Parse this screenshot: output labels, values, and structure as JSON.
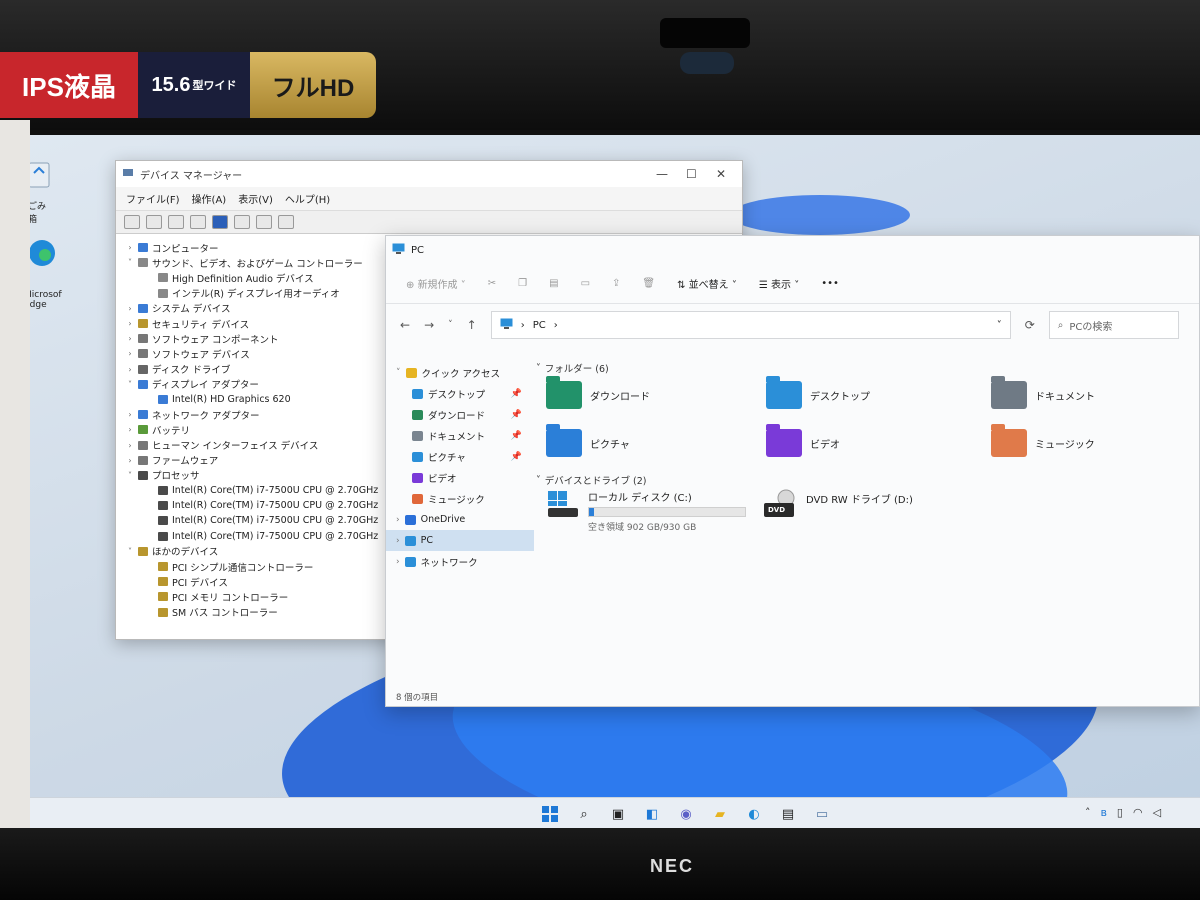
{
  "stickers": {
    "ips": "IPS液晶",
    "size": "15.6",
    "size_unit": "型ワイド",
    "fullhd": "フルHD"
  },
  "bezel": {
    "brand": "NEC"
  },
  "desktop": {
    "icons": [
      {
        "label": "ごみ箱",
        "icon": "recycle-bin-icon"
      },
      {
        "label": "Microsoft Edge",
        "icon": "edge-icon"
      }
    ]
  },
  "device_manager": {
    "title": "デバイス マネージャー",
    "menu": [
      "ファイル(F)",
      "操作(A)",
      "表示(V)",
      "ヘルプ(H)"
    ],
    "tree": [
      {
        "label": "コンピューター",
        "depth": 1,
        "expand": "collapsed",
        "icon_color": "#3a7bd5"
      },
      {
        "label": "サウンド、ビデオ、およびゲーム コントローラー",
        "depth": 1,
        "expand": "expanded",
        "icon_color": "#888888"
      },
      {
        "label": "High Definition Audio デバイス",
        "depth": 2,
        "expand": "none",
        "icon_color": "#888888"
      },
      {
        "label": "インテル(R) ディスプレイ用オーディオ",
        "depth": 2,
        "expand": "none",
        "icon_color": "#888888"
      },
      {
        "label": "システム デバイス",
        "depth": 1,
        "expand": "collapsed",
        "icon_color": "#3a7bd5"
      },
      {
        "label": "セキュリティ デバイス",
        "depth": 1,
        "expand": "collapsed",
        "icon_color": "#b8962e"
      },
      {
        "label": "ソフトウェア コンポーネント",
        "depth": 1,
        "expand": "collapsed",
        "icon_color": "#777777"
      },
      {
        "label": "ソフトウェア デバイス",
        "depth": 1,
        "expand": "collapsed",
        "icon_color": "#777777"
      },
      {
        "label": "ディスク ドライブ",
        "depth": 1,
        "expand": "collapsed",
        "icon_color": "#666666"
      },
      {
        "label": "ディスプレイ アダプター",
        "depth": 1,
        "expand": "expanded",
        "icon_color": "#3a7bd5"
      },
      {
        "label": "Intel(R) HD Graphics 620",
        "depth": 2,
        "expand": "none",
        "icon_color": "#3a7bd5"
      },
      {
        "label": "ネットワーク アダプター",
        "depth": 1,
        "expand": "collapsed",
        "icon_color": "#3a7bd5"
      },
      {
        "label": "バッテリ",
        "depth": 1,
        "expand": "collapsed",
        "icon_color": "#5a9a3a"
      },
      {
        "label": "ヒューマン インターフェイス デバイス",
        "depth": 1,
        "expand": "collapsed",
        "icon_color": "#777777"
      },
      {
        "label": "ファームウェア",
        "depth": 1,
        "expand": "collapsed",
        "icon_color": "#777777"
      },
      {
        "label": "プロセッサ",
        "depth": 1,
        "expand": "expanded",
        "icon_color": "#4a4a4a"
      },
      {
        "label": "Intel(R) Core(TM) i7-7500U CPU @ 2.70GHz",
        "depth": 2,
        "expand": "none",
        "icon_color": "#4a4a4a"
      },
      {
        "label": "Intel(R) Core(TM) i7-7500U CPU @ 2.70GHz",
        "depth": 2,
        "expand": "none",
        "icon_color": "#4a4a4a"
      },
      {
        "label": "Intel(R) Core(TM) i7-7500U CPU @ 2.70GHz",
        "depth": 2,
        "expand": "none",
        "icon_color": "#4a4a4a"
      },
      {
        "label": "Intel(R) Core(TM) i7-7500U CPU @ 2.70GHz",
        "depth": 2,
        "expand": "none",
        "icon_color": "#4a4a4a"
      },
      {
        "label": "ほかのデバイス",
        "depth": 1,
        "expand": "expanded",
        "icon_color": "#b8962e"
      },
      {
        "label": "PCI シンプル通信コントローラー",
        "depth": 2,
        "expand": "none",
        "icon_color": "#b8962e"
      },
      {
        "label": "PCI デバイス",
        "depth": 2,
        "expand": "none",
        "icon_color": "#b8962e"
      },
      {
        "label": "PCI メモリ コントローラー",
        "depth": 2,
        "expand": "none",
        "icon_color": "#b8962e"
      },
      {
        "label": "SM バス コントローラー",
        "depth": 2,
        "expand": "none",
        "icon_color": "#b8962e"
      }
    ]
  },
  "explorer": {
    "title": "PC",
    "commands": {
      "new": "新規作成",
      "sort": "並べ替え",
      "view": "表示",
      "more": "•••"
    },
    "address": {
      "root": "PC",
      "search_placeholder": "PCの検索"
    },
    "sidebar": [
      {
        "label": "クイック アクセス",
        "indent": 0,
        "icon": "star-icon",
        "color": "#e6b422",
        "pinned": false,
        "selected": false
      },
      {
        "label": "デスクトップ",
        "indent": 1,
        "icon": "desktop-icon",
        "color": "#2b8fd8",
        "pinned": true,
        "selected": false
      },
      {
        "label": "ダウンロード",
        "indent": 1,
        "icon": "download-icon",
        "color": "#2a8a5a",
        "pinned": true,
        "selected": false
      },
      {
        "label": "ドキュメント",
        "indent": 1,
        "icon": "document-icon",
        "color": "#7a8590",
        "pinned": true,
        "selected": false
      },
      {
        "label": "ピクチャ",
        "indent": 1,
        "icon": "pictures-icon",
        "color": "#2b8fd8",
        "pinned": true,
        "selected": false
      },
      {
        "label": "ビデオ",
        "indent": 1,
        "icon": "video-icon",
        "color": "#7a3ad8",
        "pinned": false,
        "selected": false
      },
      {
        "label": "ミュージック",
        "indent": 1,
        "icon": "music-icon",
        "color": "#e0673a",
        "pinned": false,
        "selected": false
      },
      {
        "label": "OneDrive",
        "indent": 0,
        "icon": "onedrive-icon",
        "color": "#2b6fd8",
        "pinned": false,
        "selected": false
      },
      {
        "label": "PC",
        "indent": 0,
        "icon": "pc-icon",
        "color": "#2b8fd8",
        "pinned": false,
        "selected": true
      },
      {
        "label": "ネットワーク",
        "indent": 0,
        "icon": "network-icon",
        "color": "#2b8fd8",
        "pinned": false,
        "selected": false
      }
    ],
    "folders_header": "フォルダー (6)",
    "folders": [
      {
        "label": "ダウンロード",
        "icon": "download-folder-icon",
        "color": "#22926a"
      },
      {
        "label": "デスクトップ",
        "icon": "desktop-folder-icon",
        "color": "#2b8fd8"
      },
      {
        "label": "ドキュメント",
        "icon": "documents-folder-icon",
        "color": "#6f7a85"
      },
      {
        "label": "ピクチャ",
        "icon": "pictures-folder-icon",
        "color": "#2b7fd8"
      },
      {
        "label": "ビデオ",
        "icon": "video-folder-icon",
        "color": "#7a3ad8"
      },
      {
        "label": "ミュージック",
        "icon": "music-folder-icon",
        "color": "#e07a4a"
      }
    ],
    "drives_header": "デバイスとドライブ (2)",
    "drives": [
      {
        "label": "ローカル ディスク (C:)",
        "free_text": "空き領域 902 GB/930 GB",
        "used_fraction": 0.03
      },
      {
        "label": "DVD RW ドライブ (D:)",
        "badge": "DVD"
      }
    ],
    "status": "8 個の項目"
  },
  "taskbar": {
    "items": [
      "start-icon",
      "search-icon",
      "task-view-icon",
      "widgets-icon",
      "chat-icon",
      "file-explorer-icon",
      "edge-icon",
      "store-icon",
      "device-manager-icon"
    ]
  },
  "colors": {
    "accent": "#2b7fd8",
    "wallpaper": "#1f5fd6"
  }
}
